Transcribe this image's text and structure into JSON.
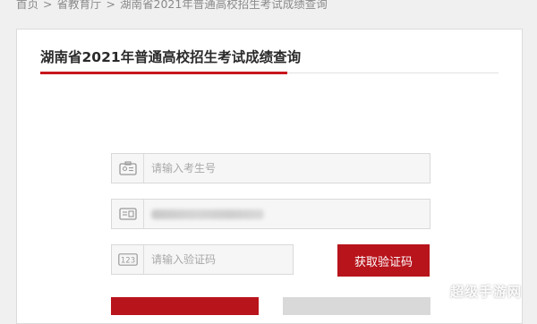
{
  "breadcrumb": {
    "items": [
      "首页",
      "省教育厅",
      "湖南省2021年普通高校招生考试成绩查询"
    ],
    "separator": ">"
  },
  "page": {
    "title": "湖南省2021年普通高校招生考试成绩查询",
    "accent_color": "#c8161d"
  },
  "form": {
    "exam_number": {
      "placeholder": "请输入考生号",
      "icon": "id-card-icon"
    },
    "id_number": {
      "value": "",
      "icon": "id-number-icon",
      "masked": true
    },
    "captcha": {
      "placeholder": "请输入验证码",
      "icon": "captcha-123-icon"
    },
    "get_code_label": "获取验证码",
    "button_color": "#b8141c"
  },
  "watermark": "超级手游网"
}
